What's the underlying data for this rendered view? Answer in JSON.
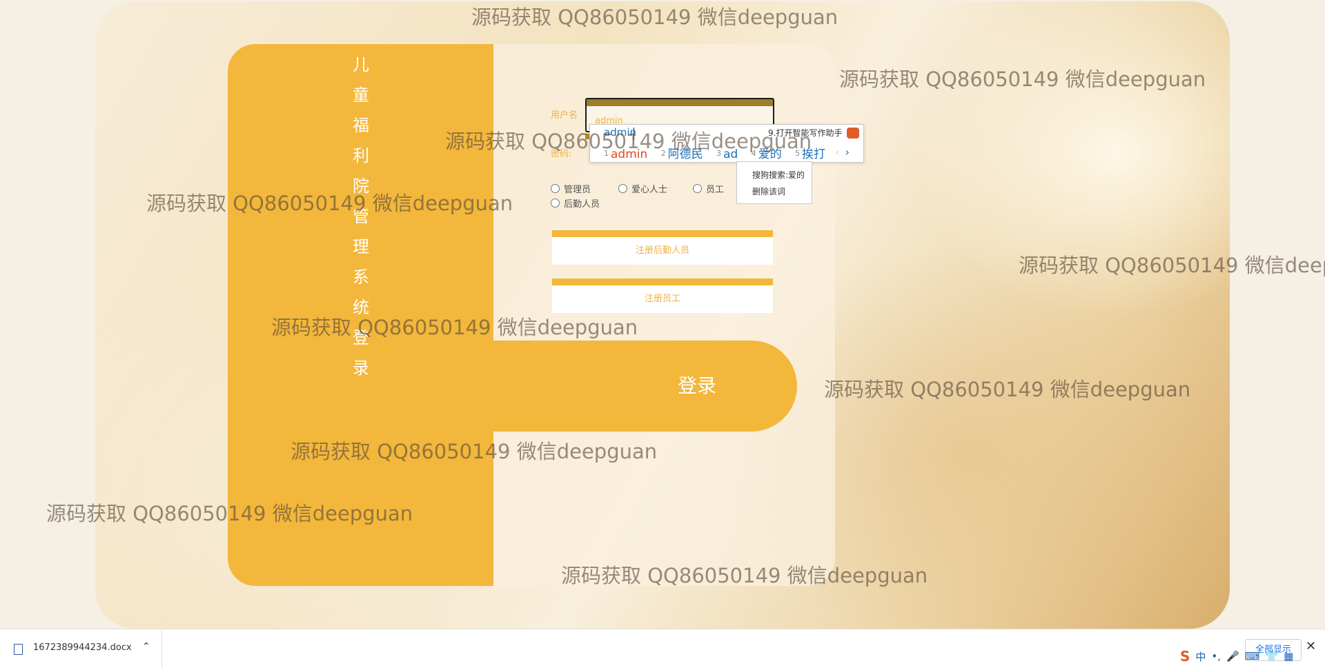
{
  "panel": {
    "vertical_title": [
      "儿",
      "童",
      "福",
      "利",
      "院",
      "管",
      "理",
      "系",
      "统",
      "登",
      "录"
    ],
    "username_label": "用户名",
    "username_value": "admin",
    "password_label": "密码:",
    "roles": [
      "管理员",
      "爱心人士",
      "员工",
      "后勤人员"
    ],
    "register_logistics_label": "注册后勤人员",
    "register_staff_label": "注册员工",
    "login_label": "登录"
  },
  "ime": {
    "pinyin": "admin",
    "assistant": "9.打开智能写作助手",
    "candidates": [
      {
        "n": "1",
        "text": "admin"
      },
      {
        "n": "2",
        "text": "阿德民"
      },
      {
        "n": "3",
        "text": "ad"
      },
      {
        "n": "4",
        "text": "爱的"
      },
      {
        "n": "5",
        "text": "挨打"
      }
    ],
    "nav_prev": "‹",
    "nav_next": "›",
    "menu": [
      "搜狗搜索:爱的",
      "删除该词"
    ]
  },
  "watermark_text": "源码获取 QQ86050149 微信deepguan",
  "download_bar": {
    "filename": "1672389944234.docx",
    "show_all": "全部显示",
    "close": "✕"
  },
  "tray": [
    "S",
    "中",
    "•,",
    "🎤",
    "⌨",
    "👕",
    "▦"
  ]
}
